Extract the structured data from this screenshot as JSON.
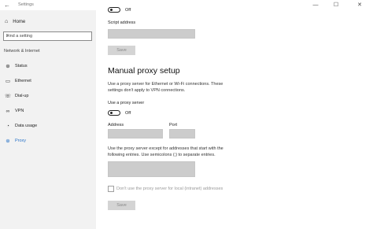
{
  "window": {
    "title": "Settings",
    "back_icon": "back-arrow-icon",
    "controls": [
      "minimize",
      "maximize",
      "close"
    ]
  },
  "sidebar": {
    "home_label": "Home",
    "search": {
      "placeholder": "Find a setting"
    },
    "section_title": "Network & Internet",
    "items": [
      {
        "label": "Status",
        "icon": "globe-icon",
        "active": false
      },
      {
        "label": "Ethernet",
        "icon": "ethernet-icon",
        "active": false
      },
      {
        "label": "Dial-up",
        "icon": "phone-icon",
        "active": false
      },
      {
        "label": "VPN",
        "icon": "vpn-icon",
        "active": false
      },
      {
        "label": "Data usage",
        "icon": "gauge-icon",
        "active": false
      },
      {
        "label": "Proxy",
        "icon": "globe-icon",
        "active": true
      }
    ]
  },
  "main": {
    "auto_toggle_state": "Off",
    "script_address_label": "Script address",
    "script_address_value": "",
    "save_label_top": "Save",
    "manual_heading": "Manual proxy setup",
    "manual_desc": "Use a proxy server for Ethernet or Wi-Fi connections. These settings don't apply to VPN connections.",
    "use_proxy_label": "Use a proxy server",
    "use_proxy_state": "Off",
    "address_label": "Address",
    "port_label": "Port",
    "exceptions_desc": "Use the proxy server except for addresses that start with the following entries. Use semicolons (;) to separate entries.",
    "local_checkbox_label": "Don't use the proxy server for local (intranet) addresses",
    "save_label_bottom": "Save"
  },
  "colors": {
    "accent": "#2a74c8",
    "sidebar_bg": "#f2f2f2",
    "field_bg": "#cccccc"
  }
}
